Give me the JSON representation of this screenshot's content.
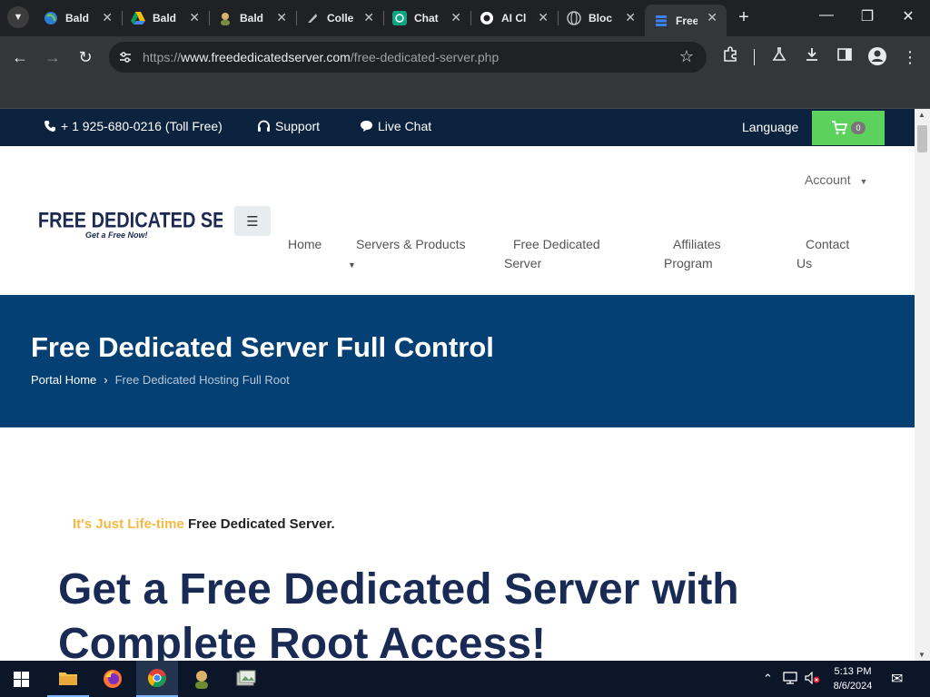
{
  "browser": {
    "tabs": [
      {
        "title": "Bald",
        "icon": "globe-icon"
      },
      {
        "title": "Bald",
        "icon": "google-drive-icon"
      },
      {
        "title": "Bald",
        "icon": "person-icon"
      },
      {
        "title": "Colle",
        "icon": "quill-icon"
      },
      {
        "title": "Chat",
        "icon": "chatgpt-icon"
      },
      {
        "title": "AI Cl",
        "icon": "ai-icon"
      },
      {
        "title": "Bloc",
        "icon": "globe-grey-icon"
      },
      {
        "title": "Free",
        "icon": "server-stack-icon",
        "active": true
      }
    ],
    "url_prefix": "https://",
    "url_host": "www.freededicatedserver.com",
    "url_path": "/free-dedicated-server.php"
  },
  "topbar": {
    "phone": "+ 1 925-680-0216 (Toll Free)",
    "support": "Support",
    "live_chat": "Live Chat",
    "language": "Language",
    "cart_count": "0"
  },
  "header": {
    "logo_main": "FREE DEDICATED SERVER",
    "logo_sub": "Get a Free Now!",
    "account": "Account",
    "nav": {
      "home": "Home",
      "servers": "Servers & Products",
      "free_dedicated_l1": "Free Dedicated",
      "free_dedicated_l2": "Server",
      "affiliates_l1": "Affiliates",
      "affiliates_l2": "Program",
      "contact_l1": "Contact",
      "contact_l2": "Us"
    }
  },
  "hero": {
    "title": "Free Dedicated Server Full Control",
    "breadcrumb_home": "Portal Home",
    "breadcrumb_current": "Free Dedicated Hosting Full Root"
  },
  "content": {
    "tagline_highlight": "It's Just Life-time",
    "tagline_rest": "Free Dedicated Server.",
    "headline_l1": "Get a Free Dedicated Server with",
    "headline_l2": "Complete Root Access!"
  },
  "taskbar": {
    "time": "5:13 PM",
    "date": "8/6/2024"
  },
  "colors": {
    "topbar_bg": "#0c2340",
    "hero_bg": "#054074",
    "cart_bg": "#5cd25c",
    "tagline_accent": "#f4b942",
    "headline": "#192b54"
  }
}
